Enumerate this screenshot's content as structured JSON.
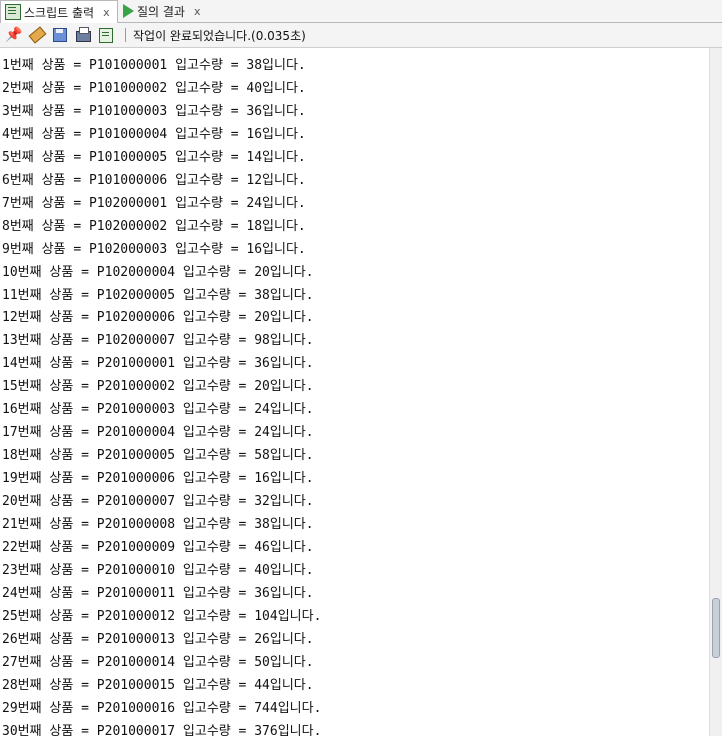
{
  "tabs": [
    {
      "label": "스크립트 출력",
      "close": "x",
      "icon": "script-output-icon",
      "active": true
    },
    {
      "label": "질의 결과",
      "close": "x",
      "icon": "play-icon",
      "active": false
    }
  ],
  "toolbar": {
    "buttons": [
      "pin-icon",
      "eraser-icon",
      "save-icon",
      "print-icon",
      "export-icon"
    ],
    "status": "작업이 완료되었습니다.(0.035초)"
  },
  "output_lines": [
    "1번째 상품 = P101000001 입고수량 = 38입니다.",
    "2번째 상품 = P101000002 입고수량 = 40입니다.",
    "3번째 상품 = P101000003 입고수량 = 36입니다.",
    "4번째 상품 = P101000004 입고수량 = 16입니다.",
    "5번째 상품 = P101000005 입고수량 = 14입니다.",
    "6번째 상품 = P101000006 입고수량 = 12입니다.",
    "7번째 상품 = P102000001 입고수량 = 24입니다.",
    "8번째 상품 = P102000002 입고수량 = 18입니다.",
    "9번째 상품 = P102000003 입고수량 = 16입니다.",
    "10번째 상품 = P102000004 입고수량 = 20입니다.",
    "11번째 상품 = P102000005 입고수량 = 38입니다.",
    "12번째 상품 = P102000006 입고수량 = 20입니다.",
    "13번째 상품 = P102000007 입고수량 = 98입니다.",
    "14번째 상품 = P201000001 입고수량 = 36입니다.",
    "15번째 상품 = P201000002 입고수량 = 20입니다.",
    "16번째 상품 = P201000003 입고수량 = 24입니다.",
    "17번째 상품 = P201000004 입고수량 = 24입니다.",
    "18번째 상품 = P201000005 입고수량 = 58입니다.",
    "19번째 상품 = P201000006 입고수량 = 16입니다.",
    "20번째 상품 = P201000007 입고수량 = 32입니다.",
    "21번째 상품 = P201000008 입고수량 = 38입니다.",
    "22번째 상품 = P201000009 입고수량 = 46입니다.",
    "23번째 상품 = P201000010 입고수량 = 40입니다.",
    "24번째 상품 = P201000011 입고수량 = 36입니다.",
    "25번째 상품 = P201000012 입고수량 = 104입니다.",
    "26번째 상품 = P201000013 입고수량 = 26입니다.",
    "27번째 상품 = P201000014 입고수량 = 50입니다.",
    "28번째 상품 = P201000015 입고수량 = 44입니다.",
    "29번째 상품 = P201000016 입고수량 = 744입니다.",
    "30번째 상품 = P201000017 입고수량 = 376입니다."
  ]
}
